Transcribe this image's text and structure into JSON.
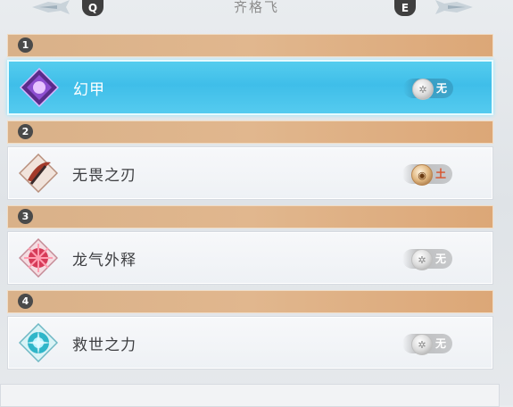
{
  "header": {
    "prev_key": "Q",
    "next_key": "E",
    "character_name": "齐格飞"
  },
  "skills": [
    {
      "slot": "1",
      "name": "幻甲",
      "element": "无",
      "element_icon": "none-element-icon",
      "selected": true
    },
    {
      "slot": "2",
      "name": "无畏之刃",
      "element": "土",
      "element_icon": "earth-element-icon",
      "selected": false
    },
    {
      "slot": "3",
      "name": "龙气外释",
      "element": "无",
      "element_icon": "none-element-icon",
      "selected": false
    },
    {
      "slot": "4",
      "name": "救世之力",
      "element": "无",
      "element_icon": "none-element-icon",
      "selected": false
    }
  ],
  "colors": {
    "selected_card": "#3fbee9",
    "group_header": "#e1b78e",
    "earth_text": "#d9532c"
  }
}
